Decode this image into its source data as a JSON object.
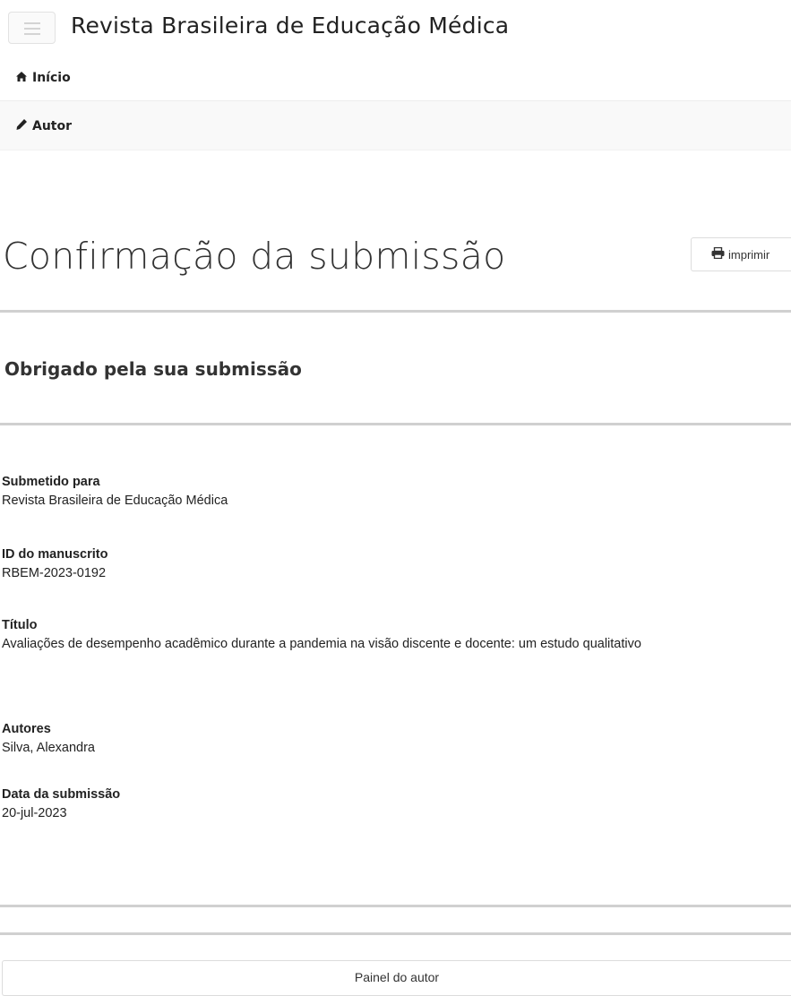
{
  "header": {
    "brand": "Revista Brasileira de Educação Médica"
  },
  "nav": {
    "home_label": "Início",
    "author_label": "Autor"
  },
  "page": {
    "title": "Confirmação da submissão",
    "print_label": "imprimir",
    "subtitle": "Obrigado pela sua submissão"
  },
  "fields": [
    {
      "label": "Submetido para",
      "value": "Revista Brasileira de Educação Médica"
    },
    {
      "label": "ID do manuscrito",
      "value": "RBEM-2023-0192"
    },
    {
      "label": "Título",
      "value": "Avaliações de desempenho acadêmico durante a pandemia na visão discente e docente: um estudo qualitativo"
    },
    {
      "label": "Autores",
      "value": "Silva, Alexandra"
    },
    {
      "label": "Data da submissão",
      "value": "20-jul-2023"
    }
  ],
  "footer": {
    "dashboard_label": "Painel do autor"
  },
  "icons": {
    "menu": "hamburger-menu-icon",
    "home": "home-icon",
    "author": "pencil-icon",
    "print": "printer-icon"
  }
}
